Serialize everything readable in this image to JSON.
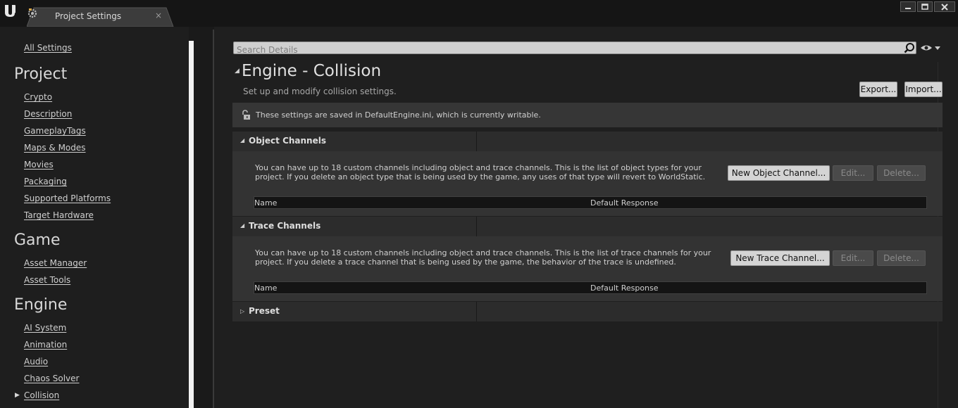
{
  "window": {
    "tab_label": "Project Settings",
    "tab_close": "×",
    "colors": {
      "titlebar": "#151515",
      "panel": "#1e1e1e",
      "accent_button": "#d4d4d4"
    }
  },
  "sidebar": {
    "all_settings": "All Settings",
    "sections": [
      {
        "heading": "Project",
        "items": [
          "Crypto",
          "Description",
          "GameplayTags",
          "Maps & Modes",
          "Movies",
          "Packaging",
          "Supported Platforms",
          "Target Hardware"
        ]
      },
      {
        "heading": "Game",
        "items": [
          "Asset Manager",
          "Asset Tools"
        ]
      },
      {
        "heading": "Engine",
        "items": [
          "AI System",
          "Animation",
          "Audio",
          "Chaos Solver",
          "Collision"
        ]
      }
    ],
    "selected_item": "Collision"
  },
  "main": {
    "search": {
      "placeholder": "Search Details",
      "value": ""
    },
    "title": "Engine - Collision",
    "subtitle": "Set up and modify collision settings.",
    "export_label": "Export...",
    "import_label": "Import...",
    "notice": "These settings are saved in DefaultEngine.ini, which is currently writable.",
    "object_channels": {
      "title": "Object Channels",
      "description": "You can have up to 18 custom channels including object and trace channels. This is the list of object types for your project. If you delete an object type that is being used by the game, any uses of that type will revert to WorldStatic.",
      "new_label": "New Object Channel...",
      "edit_label": "Edit...",
      "delete_label": "Delete...",
      "columns": [
        "Name",
        "Default Response"
      ]
    },
    "trace_channels": {
      "title": "Trace Channels",
      "description": "You can have up to 18 custom channels including object and trace channels. This is the list of trace channels for your project. If you delete a trace channel that is being used by the game, the behavior of the trace is undefined.",
      "new_label": "New Trace Channel...",
      "edit_label": "Edit...",
      "delete_label": "Delete...",
      "columns": [
        "Name",
        "Default Response"
      ]
    },
    "preset": {
      "title": "Preset"
    }
  }
}
